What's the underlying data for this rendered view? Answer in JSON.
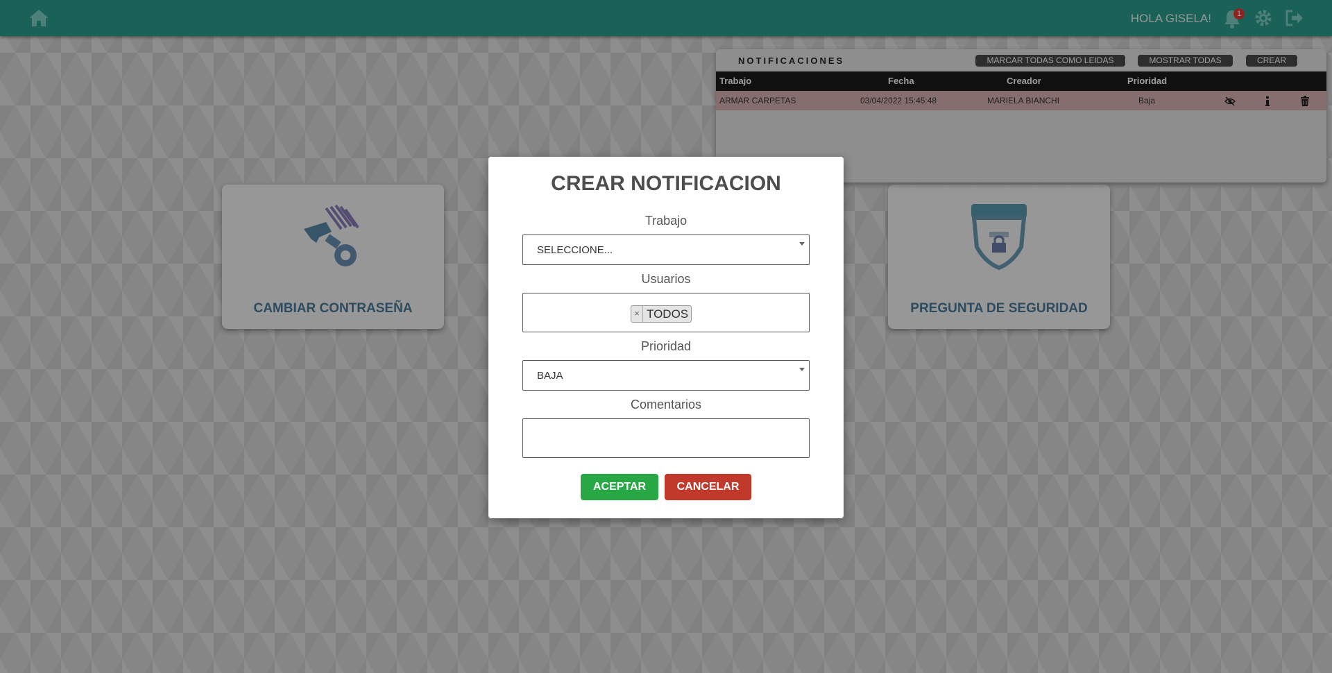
{
  "topbar": {
    "greeting": "HOLA GISELA!",
    "notification_count": "1",
    "icons": [
      "home-icon",
      "bell-icon",
      "gear-icon",
      "logout-icon"
    ]
  },
  "cards": {
    "change_password": "CAMBIAR CONTRASEÑA",
    "security_question": "PREGUNTA DE SEGURIDAD"
  },
  "notifications": {
    "title": "NOTIFICACIONES",
    "mark_all_read": "MARCAR TODAS COMO LEIDAS",
    "show_all": "MOSTRAR TODAS",
    "create": "CREAR",
    "columns": [
      "Trabajo",
      "Fecha",
      "Creador",
      "Prioridad"
    ],
    "rows": [
      {
        "trabajo": "ARMAR CARPETAS",
        "fecha": "03/04/2022 15:45:48",
        "creador": "MARIELA BIANCHI",
        "prioridad": "Baja"
      }
    ]
  },
  "modal": {
    "title": "CREAR NOTIFICACION",
    "trabajo_label": "Trabajo",
    "trabajo_value": "SELECCIONE...",
    "usuarios_label": "Usuarios",
    "usuarios_tag": "TODOS",
    "usuarios_tag_remove": "×",
    "prioridad_label": "Prioridad",
    "prioridad_value": "BAJA",
    "comentarios_label": "Comentarios",
    "comentarios_value": "",
    "accept": "ACEPTAR",
    "cancel": "CANCELAR"
  },
  "colors": {
    "topbar": "#2a9d8f",
    "accept": "#28a745",
    "cancel": "#c0392b",
    "row_highlight": "#d9b2b2"
  }
}
